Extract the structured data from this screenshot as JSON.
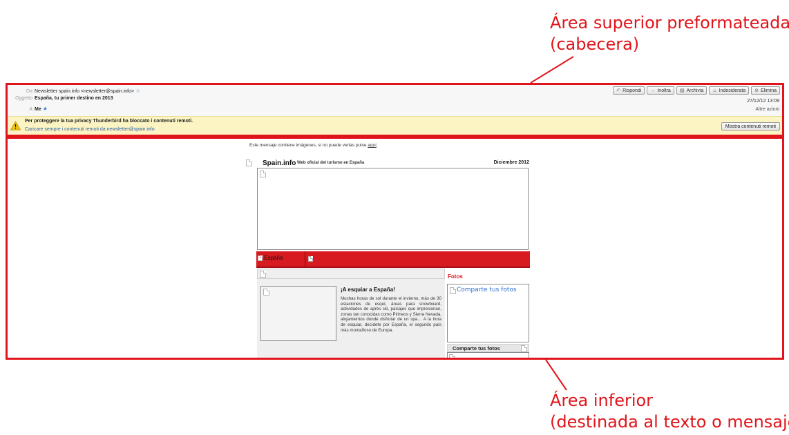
{
  "annotations": {
    "top_line1": "Área superior preformateada",
    "top_line2": "(cabecera)",
    "bottom_line1": "Área inferior",
    "bottom_line2": "(destinada al texto o mensaje)",
    "color": "#e0151b"
  },
  "header": {
    "from_label": "Da",
    "from_value": "Newsletter spain.info <newsletter@spain.info>",
    "subject_label": "Oggetto",
    "subject_value": "España, tu primer destino en 2013",
    "to_label": "A",
    "to_value": "Me",
    "date": "27/12/12 13:09",
    "other_actions": "Altre azioni",
    "toolbar": [
      {
        "icon": "reply-icon",
        "glyph": "↶",
        "label": "Rispondi"
      },
      {
        "icon": "forward-icon",
        "glyph": "→",
        "label": "Inoltra"
      },
      {
        "icon": "archive-icon",
        "glyph": "▤",
        "label": "Archivia"
      },
      {
        "icon": "junk-icon",
        "glyph": "♨",
        "label": "Indesiderata"
      },
      {
        "icon": "delete-icon",
        "glyph": "⊘",
        "label": "Elimina"
      }
    ]
  },
  "warning": {
    "title": "Per proteggere la tua privacy Thunderbird ha bloccato i contenuti remoti.",
    "link": "Caricare sempre i contenuti remoti da newsletter@spain.info",
    "button": "Mostra contenuti remoti",
    "bg_color": "#fcf4c2"
  },
  "message": {
    "intro_text": "Este mensaje contiene imágenes, si no puede verlas pulse",
    "intro_link": "aquí",
    "intro_end": ".",
    "brand": "Spain.info",
    "tagline": "Web oficial del turismo en España",
    "month": "Diciembre 2012",
    "nav_tab": "España",
    "article_title": "¡A esquiar a España!",
    "article_body": "Muchas horas de sol durante el invierno, más de 30 estaciones de esquí, áreas para snowboard, actividades de après ski, paisajes que impresionan, zonas tan conocidas como Pirineos y Sierra Nevada, alojamientos donde disfrutar de un spa… A la hora de esquiar, decídete por España, el segundo país más montañoso de Europa.",
    "fotos_heading": "Fotos",
    "fotos_link": "Comparte tus fotos",
    "fotos_bar": "Comparte tus fotos",
    "accent_color": "#d71920"
  }
}
